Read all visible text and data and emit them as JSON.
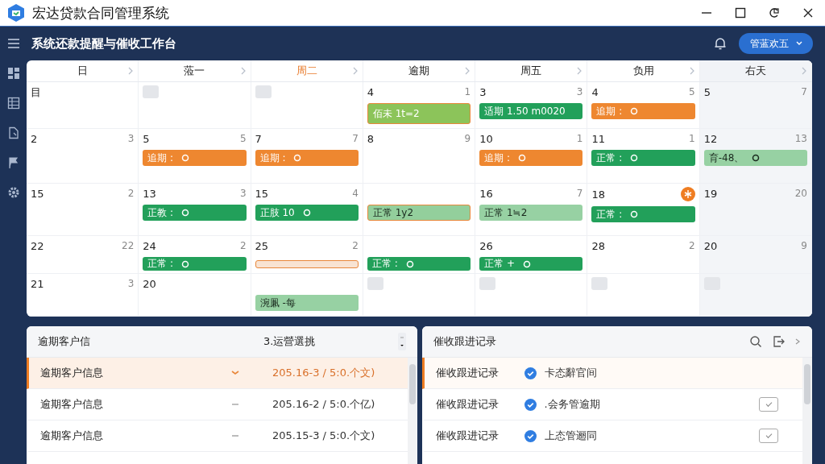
{
  "window": {
    "title": "宏达贷款合同管理系统"
  },
  "header": {
    "title": "系统还款提醒与催收工作台",
    "user_button": "管蓝欢五"
  },
  "calendar": {
    "columns": [
      {
        "label": "日",
        "selected": false,
        "shaded": false
      },
      {
        "label": "蒞一",
        "selected": false,
        "shaded": false
      },
      {
        "label": "周二",
        "selected": true,
        "shaded": false
      },
      {
        "label": "逾期",
        "selected": false,
        "shaded": false
      },
      {
        "label": "周五",
        "selected": false,
        "shaded": false
      },
      {
        "label": "负用",
        "selected": false,
        "shaded": false
      },
      {
        "label": "右天",
        "selected": false,
        "shaded": true
      }
    ],
    "rows": [
      [
        {
          "day": "目"
        },
        {
          "placeholder": true
        },
        {
          "placeholder": true
        },
        {
          "day": "4",
          "count": "1",
          "events": [
            {
              "kind": "pending",
              "label": "佰未 1t=2",
              "icon": false
            }
          ]
        },
        {
          "day": "3",
          "count": "3",
          "events": [
            {
              "kind": "normal",
              "label": "适期 1.50 m0020",
              "icon": false
            }
          ]
        },
        {
          "day": "4",
          "count": "5",
          "events": [
            {
              "kind": "overdue",
              "label": "追期 :",
              "icon": true
            }
          ]
        },
        {
          "day": "5",
          "count": "7"
        }
      ],
      [
        {
          "day": "2",
          "count": "3"
        },
        {
          "day": "5",
          "count": "5",
          "events": [
            {
              "kind": "overdue",
              "label": "追期 :",
              "icon": true
            }
          ]
        },
        {
          "day": "7",
          "count": "7",
          "events": [
            {
              "kind": "overdue",
              "label": "追期 :",
              "icon": true
            }
          ]
        },
        {
          "day": "8",
          "count": "9"
        },
        {
          "day": "10",
          "count": "1",
          "events": [
            {
              "kind": "overdue",
              "label": "追期 :",
              "icon": true
            }
          ]
        },
        {
          "day": "11",
          "count": "1",
          "events": [
            {
              "kind": "normal",
              "label": "正常 :",
              "icon": true
            }
          ]
        },
        {
          "day": "12",
          "count": "13",
          "events": [
            {
              "kind": "light",
              "label": "育-48、",
              "icon": true
            }
          ]
        }
      ],
      [
        {
          "day": "15",
          "count": "2"
        },
        {
          "day": "13",
          "count": "3",
          "events": [
            {
              "kind": "normal",
              "label": "正教 :",
              "icon": true
            }
          ]
        },
        {
          "day": "15",
          "count": "4",
          "events": [
            {
              "kind": "normal",
              "label": "正肢 10",
              "icon": true
            }
          ]
        },
        {
          "events": [
            {
              "kind": "pending-light",
              "label": "正常 1y2",
              "icon": false
            }
          ]
        },
        {
          "day": "16",
          "count": "7",
          "events": [
            {
              "kind": "light",
              "label": "正常 1≒2",
              "icon": false
            }
          ]
        },
        {
          "day": "18",
          "badge": true,
          "events": [
            {
              "kind": "normal",
              "label": "正常 :",
              "icon": true
            }
          ]
        },
        {
          "day": "19",
          "count": "20"
        }
      ],
      [
        {
          "day": "22",
          "count": "22"
        },
        {
          "day": "24",
          "count": "2",
          "events": [
            {
              "kind": "normal",
              "label": "正常 :",
              "icon": true
            }
          ]
        },
        {
          "day": "25",
          "count": "2",
          "events": [
            {
              "kind": "slot"
            }
          ]
        },
        {
          "events": [
            {
              "kind": "normal",
              "label": "正常 :",
              "icon": true
            }
          ]
        },
        {
          "day": "26",
          "events": [
            {
              "kind": "normal",
              "label": "正常 +",
              "icon": true
            }
          ]
        },
        {
          "day": "28",
          "count": "2"
        },
        {
          "day": "20",
          "count": "9"
        }
      ],
      [
        {
          "day": "21",
          "count": "3"
        },
        {
          "day": "20"
        },
        {
          "events": [
            {
              "kind": "light",
              "label": "涴凲 -每",
              "icon": false
            }
          ]
        },
        {
          "placeholder": true
        },
        {
          "placeholder": true
        },
        {
          "placeholder": true
        },
        {
          "placeholder": true
        }
      ]
    ]
  },
  "overdue_panel": {
    "columns": [
      "逾期客户信",
      "3.运營選挑"
    ],
    "rows": [
      {
        "name": "逾期客户信息",
        "value": "205.16-3 / 5:0.个文)",
        "selected": true
      },
      {
        "name": "逾期客户信息",
        "value": "205.16-2 / 5:0.个亿)",
        "selected": false
      },
      {
        "name": "逾期客户信息",
        "value": "205.15-3 / 5:0.个文)",
        "selected": false
      }
    ]
  },
  "followup_panel": {
    "title": "催收跟进记录",
    "rows": [
      {
        "name": "催收跟进记录",
        "note": "卡态辭官间",
        "selected": true,
        "checkbox": false
      },
      {
        "name": "催收跟进记录",
        "note": ".会务管逾期",
        "selected": false,
        "checkbox": true
      },
      {
        "name": "催收跟进记录",
        "note": "上态管逦同",
        "selected": false,
        "checkbox": true
      }
    ]
  }
}
